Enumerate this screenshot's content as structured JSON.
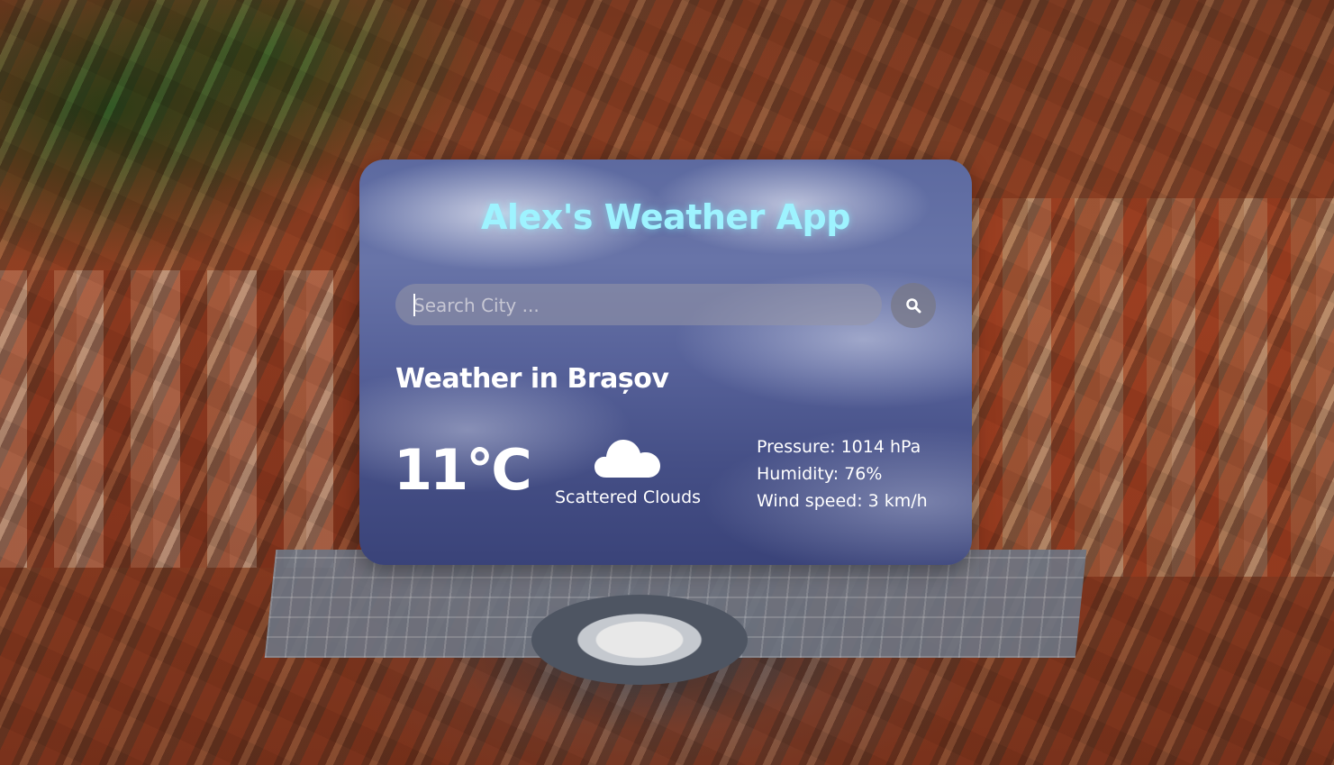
{
  "app": {
    "title": "Alex's Weather App"
  },
  "search": {
    "placeholder": "Search City ..."
  },
  "weather": {
    "location_label": "Weather in Brașov",
    "temperature": "11°C",
    "condition_icon": "cloud-icon",
    "condition": "Scattered Clouds",
    "pressure": "Pressure: 1014 hPa",
    "humidity": "Humidity: 76%",
    "wind_speed": "Wind speed: 3 km/h"
  },
  "colors": {
    "title_accent": "#9ef3ff",
    "text": "#ffffff"
  }
}
